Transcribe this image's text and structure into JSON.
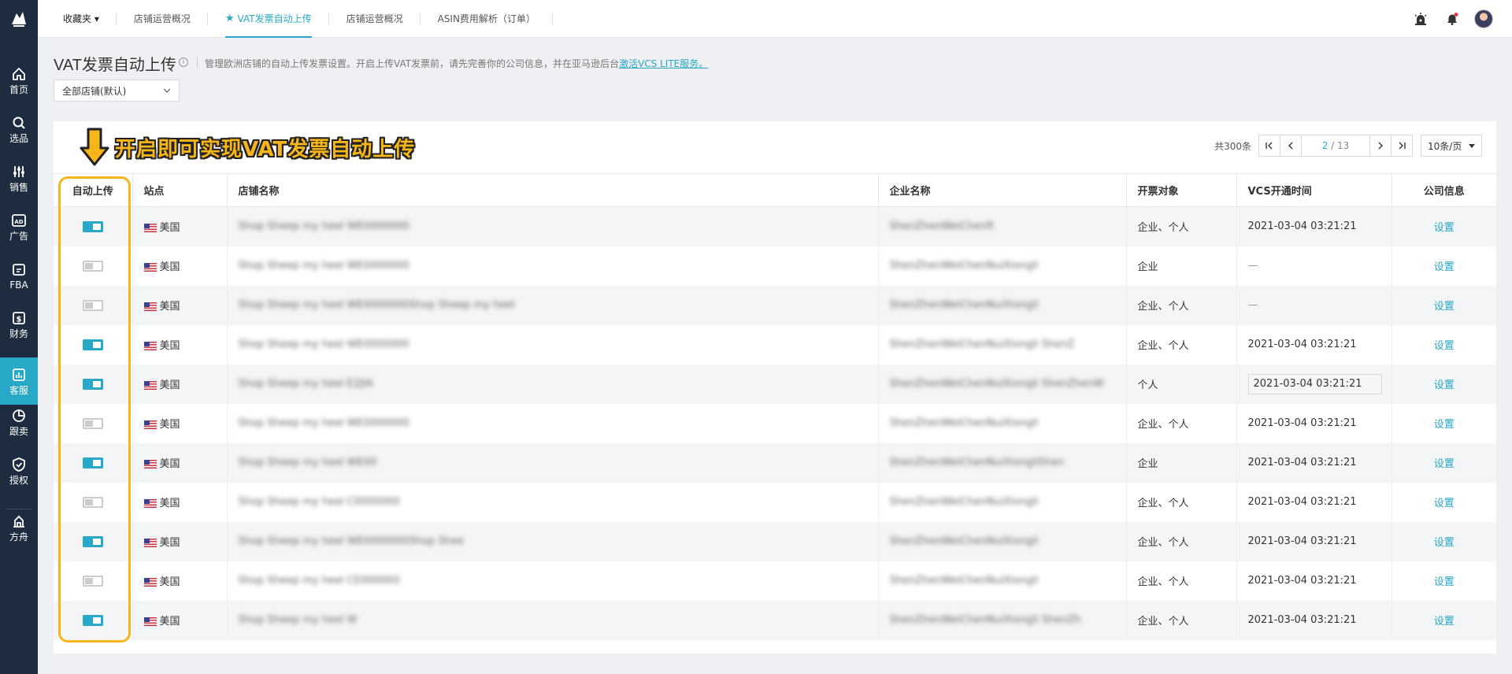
{
  "nav": {
    "items": [
      {
        "label": "首页",
        "icon": "home-icon"
      },
      {
        "label": "选品",
        "icon": "search-icon"
      },
      {
        "label": "销售",
        "icon": "sales-icon"
      },
      {
        "label": "广告",
        "icon": "ad-icon"
      },
      {
        "label": "FBA",
        "icon": "fba-icon"
      },
      {
        "label": "财务",
        "icon": "finance-icon"
      },
      {
        "label": "客服",
        "icon": "service-icon"
      },
      {
        "label": "跟卖",
        "icon": "follow-sell-icon"
      },
      {
        "label": "授权",
        "icon": "auth-icon"
      },
      {
        "label": "方舟",
        "icon": "ark-icon"
      }
    ],
    "active_index": 6
  },
  "topbar": {
    "favorites_label": "收藏夹 ▾",
    "tabs": [
      {
        "label": "店铺运营概况"
      },
      {
        "label": "VAT发票自动上传"
      },
      {
        "label": "店铺运营概况"
      },
      {
        "label": "ASIN费用解析（订单）"
      }
    ],
    "active_tab": 1
  },
  "header": {
    "title": "VAT发票自动上传",
    "description": "管理欧洲店铺的自动上传发票设置。开启上传VAT发票前，请先完善你的公司信息，并在亚马逊后台",
    "activate_link": "激活VCS LITE服务。",
    "store_filter": "全部店铺(默认)"
  },
  "banner": {
    "text": "开启即可实现VAT发票自动上传"
  },
  "pagination": {
    "total": "共300条",
    "current": "2",
    "total_pages": "/ 13",
    "page_size": "10条/页"
  },
  "table": {
    "headers": {
      "auto_upload": "自动上传",
      "site": "站点",
      "store_name": "店铺名称",
      "company": "企业名称",
      "invoice_target": "开票对象",
      "vcs_time": "VCS开通时间",
      "company_info": "公司信息"
    },
    "action_label": "设置",
    "rows": [
      {
        "on": true,
        "site": "美国",
        "store": "Shop Sheep my heel WE0000000",
        "company": "ShenZhenWeiChenft",
        "target": "企业、个人",
        "time": "2021-03-04 03:21:21"
      },
      {
        "on": false,
        "site": "美国",
        "store": "Shop Sheep my heel WE0000000",
        "company": "ShenZhenWeiChenNuiXiongli",
        "target": "企业",
        "time": "—"
      },
      {
        "on": false,
        "site": "美国",
        "store": "Shop Sheep my heel WE0000000Shop Sheep my heel",
        "company": "ShenZhenWeiChenNuiXiongli",
        "target": "企业、个人",
        "time": "—"
      },
      {
        "on": true,
        "site": "美国",
        "store": "Shop Sheep my heel WE0000000",
        "company": "ShenZhenWeiChenNuiXiongli ShenZ",
        "target": "企业、个人",
        "time": "2021-03-04 03:21:21"
      },
      {
        "on": true,
        "site": "美国",
        "store": "Shop Sheep my heel E2JIA",
        "company": "ShenZhenWeiChenNuiXiongli ShenZhenW",
        "target": "个人",
        "time": "2021-03-04 03:21:21",
        "editing": true
      },
      {
        "on": false,
        "site": "美国",
        "store": "Shop Sheep my heel WE0000000",
        "company": "ShenZhenWeiChenNuiXiongli",
        "target": "企业、个人",
        "time": "2021-03-04 03:21:21"
      },
      {
        "on": true,
        "site": "美国",
        "store": "Shop Sheep my heel WE00",
        "company": "ShenZhenWeiChenNuiXiongliShen",
        "target": "企业",
        "time": "2021-03-04 03:21:21"
      },
      {
        "on": false,
        "site": "美国",
        "store": "Shop Sheep my heel C0000000",
        "company": "ShenZhenWeiChenNuiXiongli",
        "target": "企业、个人",
        "time": "2021-03-04 03:21:21"
      },
      {
        "on": true,
        "site": "美国",
        "store": "Shop Sheep my heel WE0000000Shop Shee",
        "company": "ShenZhenWeiChenNuiXiongli",
        "target": "企业、个人",
        "time": "2021-03-04 03:21:21"
      },
      {
        "on": false,
        "site": "美国",
        "store": "Shop Sheep my heel CE000000",
        "company": "ShenZhenWeiChenNuiXiongli",
        "target": "企业、个人",
        "time": "2021-03-04 03:21:21"
      },
      {
        "on": true,
        "site": "美国",
        "store": "Shop Sheep my heel W",
        "company": "ShenZhenWeiChenNuiXiongli ShenZh",
        "target": "企业、个人",
        "time": "2021-03-04 03:21:21"
      }
    ]
  },
  "colors": {
    "accent": "#27a8c6",
    "sidebar": "#1d2d3f",
    "highlight": "#f6b51a"
  }
}
